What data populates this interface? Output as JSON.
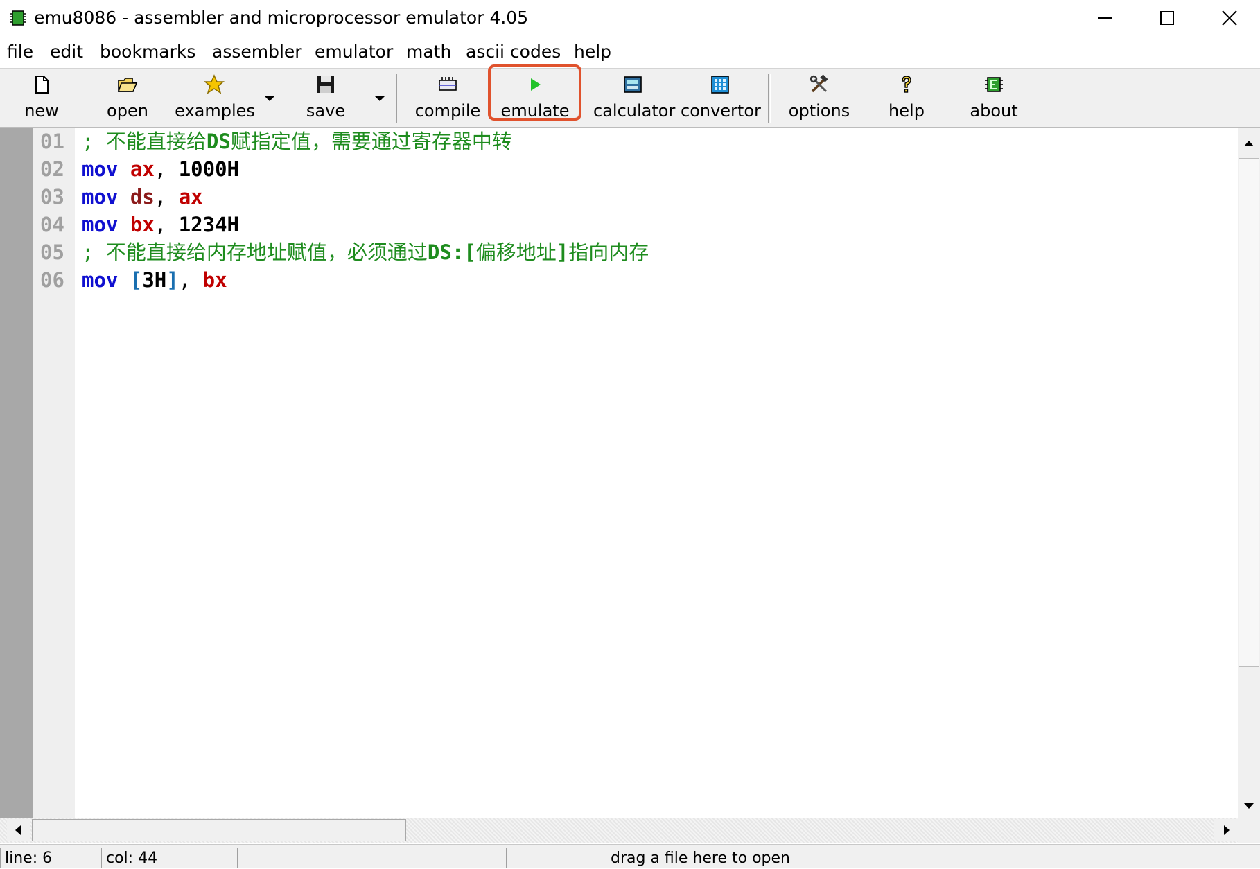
{
  "window": {
    "title": "emu8086 - assembler and microprocessor emulator 4.05"
  },
  "menu": [
    "file",
    "edit",
    "bookmarks",
    "assembler",
    "emulator",
    "math",
    "ascii codes",
    "help"
  ],
  "toolbar": {
    "new": "new",
    "open": "open",
    "examples": "examples",
    "save": "save",
    "compile": "compile",
    "emulate": "emulate",
    "calculator": "calculator",
    "convertor": "convertor",
    "options": "options",
    "help": "help",
    "about": "about"
  },
  "editor": {
    "line_numbers": [
      "01",
      "02",
      "03",
      "04",
      "05",
      "06"
    ],
    "lines": [
      {
        "tokens": [
          {
            "type": "comment",
            "text": "; 不能直接给"
          },
          {
            "type": "comment-bold",
            "text": "DS"
          },
          {
            "type": "comment",
            "text": "赋指定值，需要通过寄存器中转"
          }
        ]
      },
      {
        "tokens": [
          {
            "type": "kw",
            "text": "mov"
          },
          {
            "type": "punct",
            "text": " "
          },
          {
            "type": "reg",
            "text": "ax"
          },
          {
            "type": "punct",
            "text": ", "
          },
          {
            "type": "num",
            "text": "1000H"
          }
        ]
      },
      {
        "tokens": [
          {
            "type": "kw",
            "text": "mov"
          },
          {
            "type": "punct",
            "text": " "
          },
          {
            "type": "seg",
            "text": "ds"
          },
          {
            "type": "punct",
            "text": ", "
          },
          {
            "type": "reg",
            "text": "ax"
          }
        ]
      },
      {
        "tokens": [
          {
            "type": "kw",
            "text": "mov"
          },
          {
            "type": "punct",
            "text": " "
          },
          {
            "type": "reg",
            "text": "bx"
          },
          {
            "type": "punct",
            "text": ", "
          },
          {
            "type": "num",
            "text": "1234H"
          }
        ]
      },
      {
        "tokens": [
          {
            "type": "comment",
            "text": "; 不能直接给内存地址赋值，必须通过"
          },
          {
            "type": "comment-bold",
            "text": "DS:["
          },
          {
            "type": "comment",
            "text": "偏移地址"
          },
          {
            "type": "comment-bold",
            "text": "]"
          },
          {
            "type": "comment",
            "text": "指向内存"
          }
        ]
      },
      {
        "tokens": [
          {
            "type": "kw",
            "text": "mov"
          },
          {
            "type": "punct",
            "text": " "
          },
          {
            "type": "brk",
            "text": "["
          },
          {
            "type": "num",
            "text": "3H"
          },
          {
            "type": "brk",
            "text": "]"
          },
          {
            "type": "punct",
            "text": ", "
          },
          {
            "type": "reg",
            "text": "bx"
          }
        ]
      }
    ]
  },
  "status": {
    "line": "line: 6",
    "col": "col: 44",
    "hint": "drag a file here to open"
  },
  "colors": {
    "highlight_border": "#e0522d",
    "comment": "#1e8c1e",
    "keyword": "#1010d0",
    "register": "#c00000"
  }
}
